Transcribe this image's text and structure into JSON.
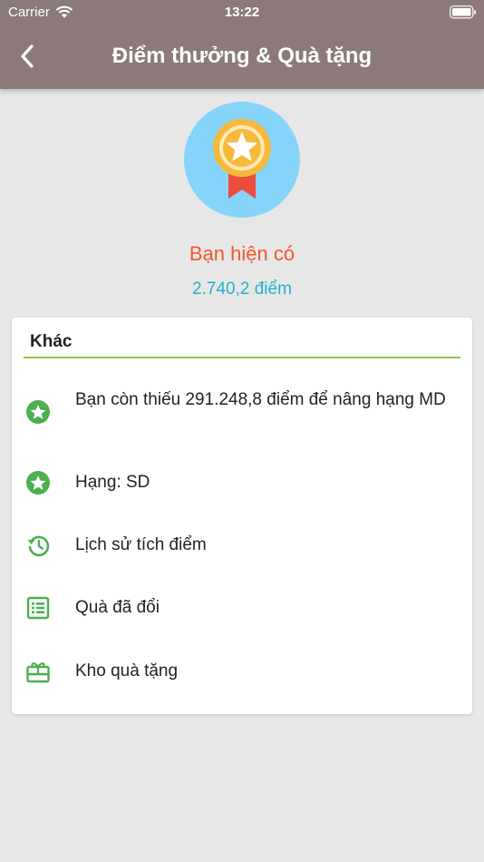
{
  "status_bar": {
    "carrier": "Carrier",
    "time": "13:22"
  },
  "header": {
    "title": "Điểm thưởng & Quà tặng",
    "back_icon": "chevron-left-icon"
  },
  "summary": {
    "label": "Bạn hiện có",
    "points": "2.740,2 điểm",
    "medal_icon": "medal-star-icon"
  },
  "card": {
    "title": "Khác",
    "items": [
      {
        "label": "Bạn còn thiếu 291.248,8 điểm để nâng hạng MD",
        "icon": "star-circle-icon"
      },
      {
        "label": "Hạng: SD",
        "icon": "star-circle-icon"
      },
      {
        "label": "Lịch sử tích điểm",
        "icon": "history-icon"
      },
      {
        "label": "Quà đã đổi",
        "icon": "list-icon"
      },
      {
        "label": "Kho quà tặng",
        "icon": "gift-icon"
      }
    ]
  },
  "colors": {
    "header_bg": "#8c7a7a",
    "accent_green": "#4caf50",
    "label_orange": "#f2572a",
    "points_blue": "#27b1cf",
    "divider_green": "#8cc63f"
  }
}
